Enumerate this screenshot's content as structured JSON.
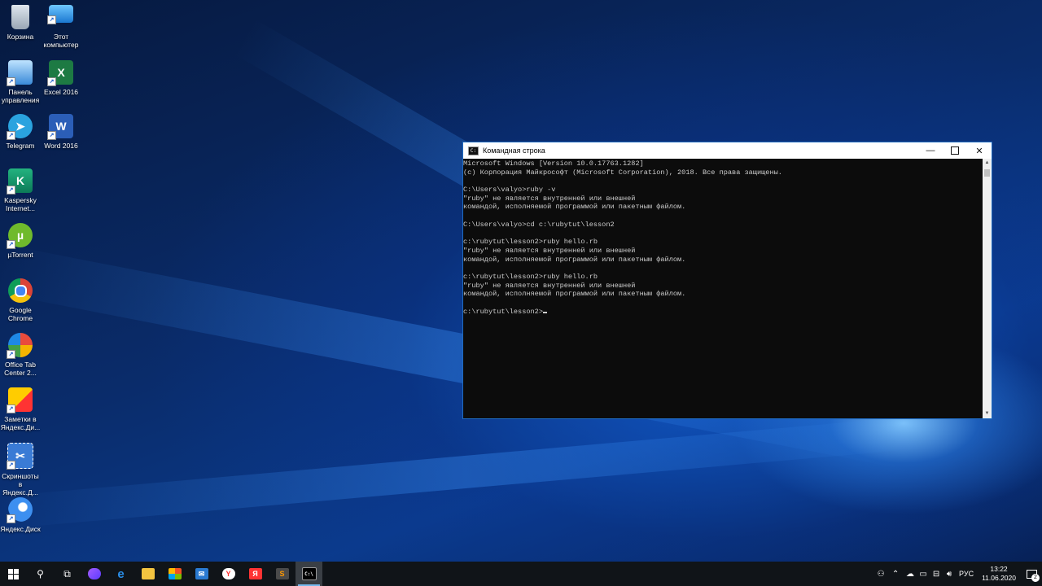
{
  "desktop": {
    "icons": [
      {
        "label": "Корзина",
        "icon": "recycle-bin-icon"
      },
      {
        "label": "Этот\nкомпьютер",
        "icon": "computer-icon"
      },
      {
        "label": "Панель\nуправления",
        "icon": "control-panel-icon"
      },
      {
        "label": "Excel 2016",
        "icon": "excel-icon",
        "glyph": "X"
      },
      {
        "label": "Telegram",
        "icon": "telegram-icon"
      },
      {
        "label": "Word 2016",
        "icon": "word-icon",
        "glyph": "W"
      },
      {
        "label": "Kaspersky\nInternet...",
        "icon": "kaspersky-icon"
      },
      {
        "label": "µTorrent",
        "icon": "utorrent-icon"
      },
      {
        "label": "Google\nChrome",
        "icon": "chrome-icon"
      },
      {
        "label": "Office Tab\nCenter 2...",
        "icon": "office-tab-icon"
      },
      {
        "label": "Заметки в\nЯндекс.Ди...",
        "icon": "yandex-notes-icon"
      },
      {
        "label": "Скриншоты\nв Яндекс.Д...",
        "icon": "yandex-screenshots-icon"
      },
      {
        "label": "Яндекс.Диск",
        "icon": "yandex-disk-icon"
      }
    ]
  },
  "window": {
    "title": "Командная строка",
    "lines": [
      "Microsoft Windows [Version 10.0.17763.1282]",
      "(c) Корпорация Майкрософт (Microsoft Corporation), 2018. Все права защищены.",
      "",
      "C:\\Users\\valyo>ruby -v",
      "\"ruby\" не является внутренней или внешней",
      "командой, исполняемой программой или пакетным файлом.",
      "",
      "C:\\Users\\valyo>cd c:\\rubytut\\lesson2",
      "",
      "c:\\rubytut\\lesson2>ruby hello.rb",
      "\"ruby\" не является внутренней или внешней",
      "командой, исполняемой программой или пакетным файлом.",
      "",
      "c:\\rubytut\\lesson2>ruby hello.rb",
      "\"ruby\" не является внутренней или внешней",
      "командой, исполняемой программой или пакетным файлом.",
      "",
      "c:\\rubytut\\lesson2>"
    ]
  },
  "taskbar": {
    "tray": {
      "language": "РУС",
      "time": "13:22",
      "date": "11.06.2020",
      "notifications": "2"
    }
  }
}
